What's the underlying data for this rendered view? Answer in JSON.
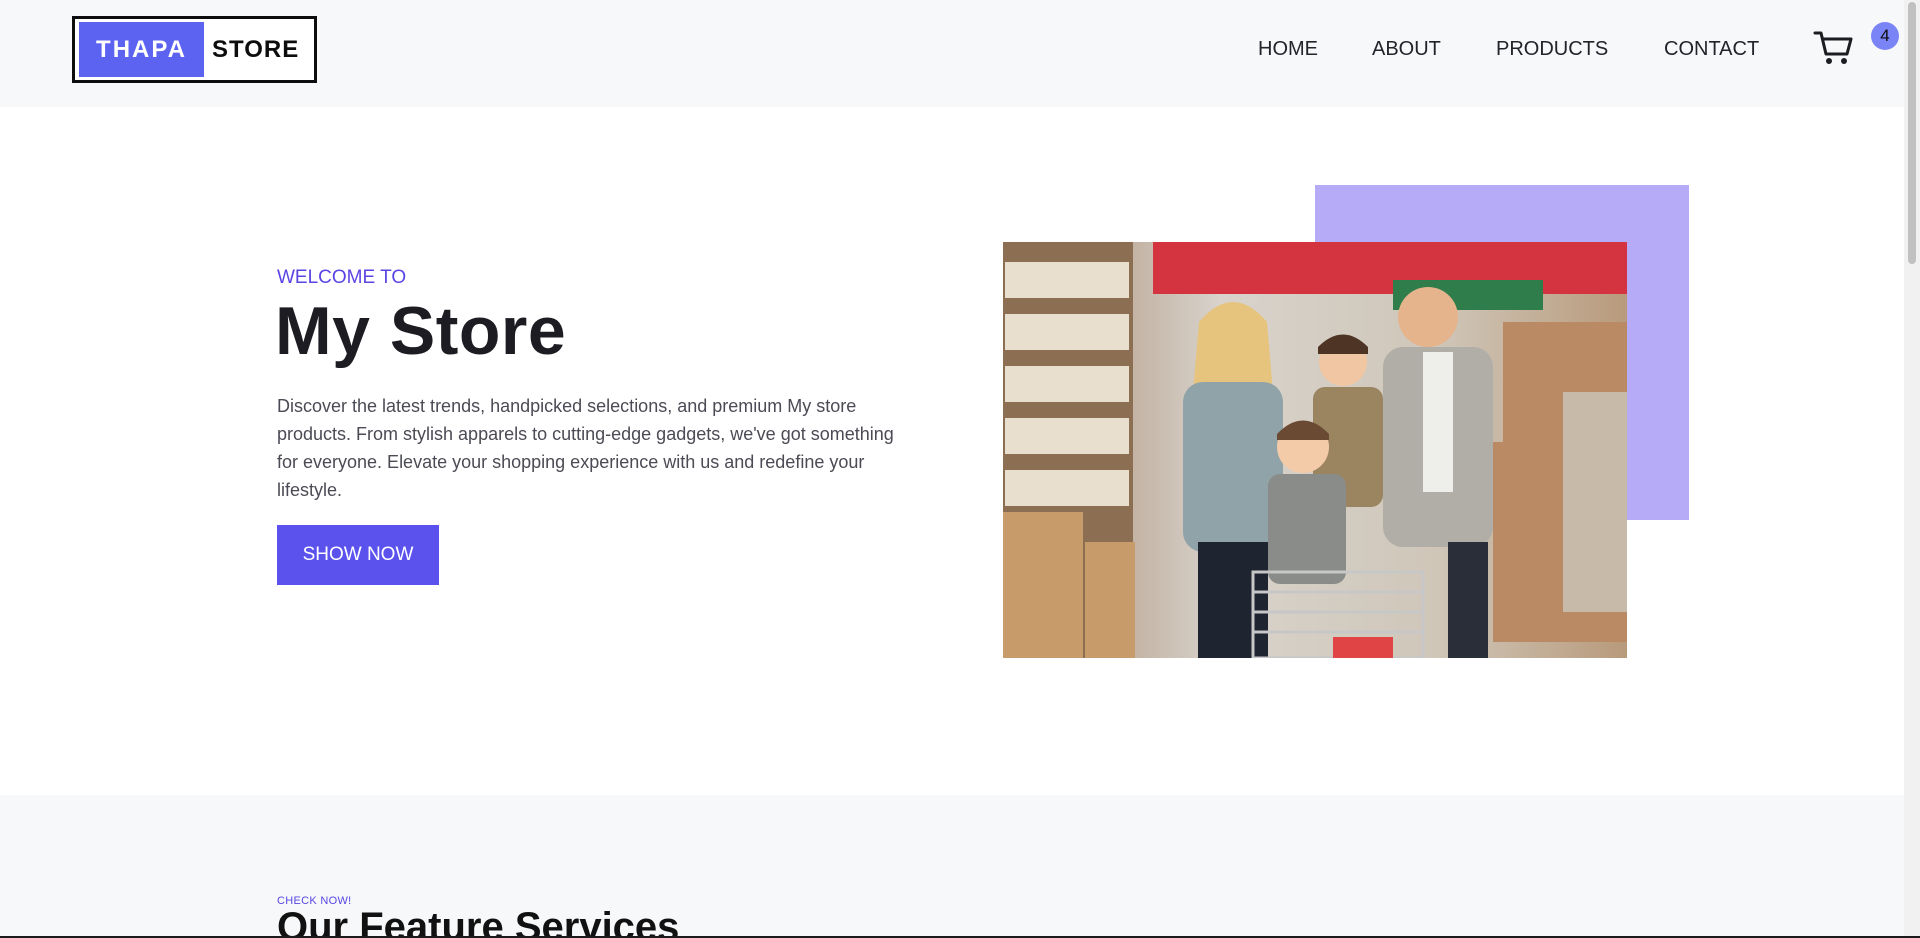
{
  "header": {
    "logo": {
      "part1": "THAPA",
      "part2": "STORE"
    },
    "nav": [
      {
        "label": "HOME"
      },
      {
        "label": "ABOUT"
      },
      {
        "label": "PRODUCTS"
      },
      {
        "label": "CONTACT"
      }
    ],
    "cart": {
      "icon": "cart-icon",
      "count": "4"
    }
  },
  "hero": {
    "eyebrow": "WELCOME TO",
    "title": "My Store",
    "description": "Discover the latest trends, handpicked selections, and premium My store products. From stylish apparels to cutting-edge gadgets, we've got something for everyone. Elevate your shopping experience with us and redefine your lifestyle.",
    "button_label": "SHOW NOW",
    "image_alt": "Family shopping with cart in store"
  },
  "features": {
    "eyebrow": "CHECK NOW!",
    "title": "Our Feature Services"
  },
  "colors": {
    "accent": "#5b52ee",
    "accent_text": "#5a45e4",
    "accent_block": "#b6abf6",
    "header_bg": "#f6f8fa"
  }
}
